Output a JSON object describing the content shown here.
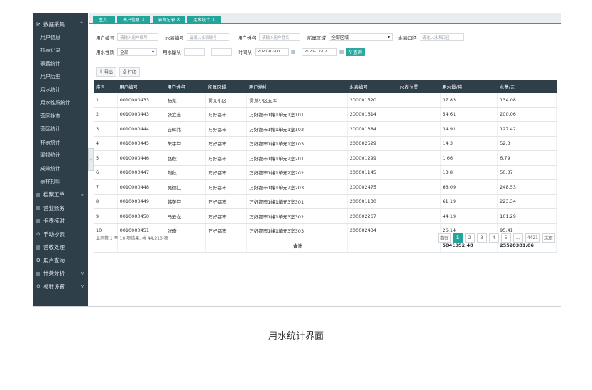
{
  "sidebar": {
    "section1": {
      "label": "数据采集",
      "chev": "^"
    },
    "subitems": [
      "用户信息",
      "抄表记录",
      "表费统计",
      "用户历史",
      "用水统计",
      "用水性质统计",
      "营区抽查",
      "营区统计",
      "样表统计",
      "漏损统计",
      "成效统计",
      "表样打印"
    ],
    "sections": [
      {
        "icon": "▤",
        "label": "档案工单",
        "chev": "v"
      },
      {
        "icon": "▤",
        "label": "营业账务",
        "chev": ""
      },
      {
        "icon": "▤",
        "label": "卡表核对",
        "chev": ""
      },
      {
        "icon": "⊙",
        "label": "手动抄表",
        "chev": ""
      },
      {
        "icon": "▤",
        "label": "营收处理",
        "chev": ""
      },
      {
        "icon": "Q",
        "label": "用户查询",
        "chev": ""
      },
      {
        "icon": "▤",
        "label": "计费分析",
        "chev": "v"
      },
      {
        "icon": "⊙",
        "label": "参数设置",
        "chev": "v"
      }
    ]
  },
  "tabs": [
    {
      "label": "主页",
      "close": ""
    },
    {
      "label": "表户信息",
      "close": "x"
    },
    {
      "label": "表费记录",
      "close": "x"
    },
    {
      "label": "用水统计",
      "close": "x"
    }
  ],
  "filters": {
    "user_no_label": "用户编号",
    "user_no_ph": "请输入用户编号",
    "meter_no_label": "水表编号",
    "meter_no_ph": "请输入水表编号",
    "user_name_label": "用户姓名",
    "user_name_ph": "请输入用户姓名",
    "area_label": "所属区域",
    "area_value": "全部区域",
    "meter_caliber_label": "水表口径",
    "meter_caliber_ph": "请输入水表口径",
    "nature_label": "用水性质",
    "nature_value": "全部",
    "usage_label": "用水量从",
    "usage_sep": "-",
    "time_label": "时间从",
    "date_from": "2021-02-01",
    "date_sep": "-",
    "date_to": "2021-12-02",
    "query_label": "查询"
  },
  "toolbar": {
    "export_label": "导出",
    "print_label": "打印"
  },
  "table": {
    "columns": [
      "序号",
      "用户编号",
      "用户姓名",
      "所属区域",
      "用户地址",
      "水表编号",
      "水表位置",
      "用水量/吨",
      "水费/元"
    ],
    "rows": [
      [
        "1",
        "0010000433",
        "杨某",
        "雾某小区",
        "雾某小区五库",
        "200001520",
        "",
        "37.83",
        "134.08"
      ],
      [
        "2",
        "0010000443",
        "张立志",
        "万好都市",
        "万好都市1幢1单元1室101",
        "200001614",
        "",
        "54.61",
        "200.06"
      ],
      [
        "3",
        "0010000444",
        "吉辉伟",
        "万好都市",
        "万好都市1幢1单元1室102",
        "200001384",
        "",
        "34.91",
        "127.42"
      ],
      [
        "4",
        "0010000445",
        "朱宇芦",
        "万好都市",
        "万好都市1幢1单元1室103",
        "200002529",
        "",
        "14.3",
        "52.3"
      ],
      [
        "5",
        "0010000446",
        "赵秋",
        "万好都市",
        "万好都市1幢1单元2室201",
        "200001299",
        "",
        "1.66",
        "6.79"
      ],
      [
        "6",
        "0010000447",
        "刘秋",
        "万好都市",
        "万好都市1幢1单元2室202",
        "200001145",
        "",
        "13.8",
        "50.37"
      ],
      [
        "7",
        "0010000448",
        "吴德仁",
        "万好都市",
        "万好都市1幢1单元2室203",
        "200002475",
        "",
        "68.09",
        "248.53"
      ],
      [
        "8",
        "0010000449",
        "韩美芦",
        "万好都市",
        "万好都市1幢1单元3室301",
        "200001130",
        "",
        "61.19",
        "223.34"
      ],
      [
        "9",
        "0010000450",
        "马云龙",
        "万好都市",
        "万好都市1幢1单元3室302",
        "200002267",
        "",
        "44.19",
        "161.29"
      ],
      [
        "10",
        "0010000451",
        "张奇",
        "万好都市",
        "万好都市1幢1单元3室303",
        "200002434",
        "",
        "26.14",
        "95.41"
      ]
    ],
    "sum_label": "合计",
    "sum_usage": "5041352.48",
    "sum_fee": "25528381.06"
  },
  "pagination": {
    "info": "显示第 1 至 10 项结果, 共 44,210 项",
    "first": "首页",
    "pages": [
      "1",
      "2",
      "3",
      "4",
      "5",
      "...",
      "4421"
    ],
    "last": "末页"
  },
  "caption": "用水统计界面"
}
